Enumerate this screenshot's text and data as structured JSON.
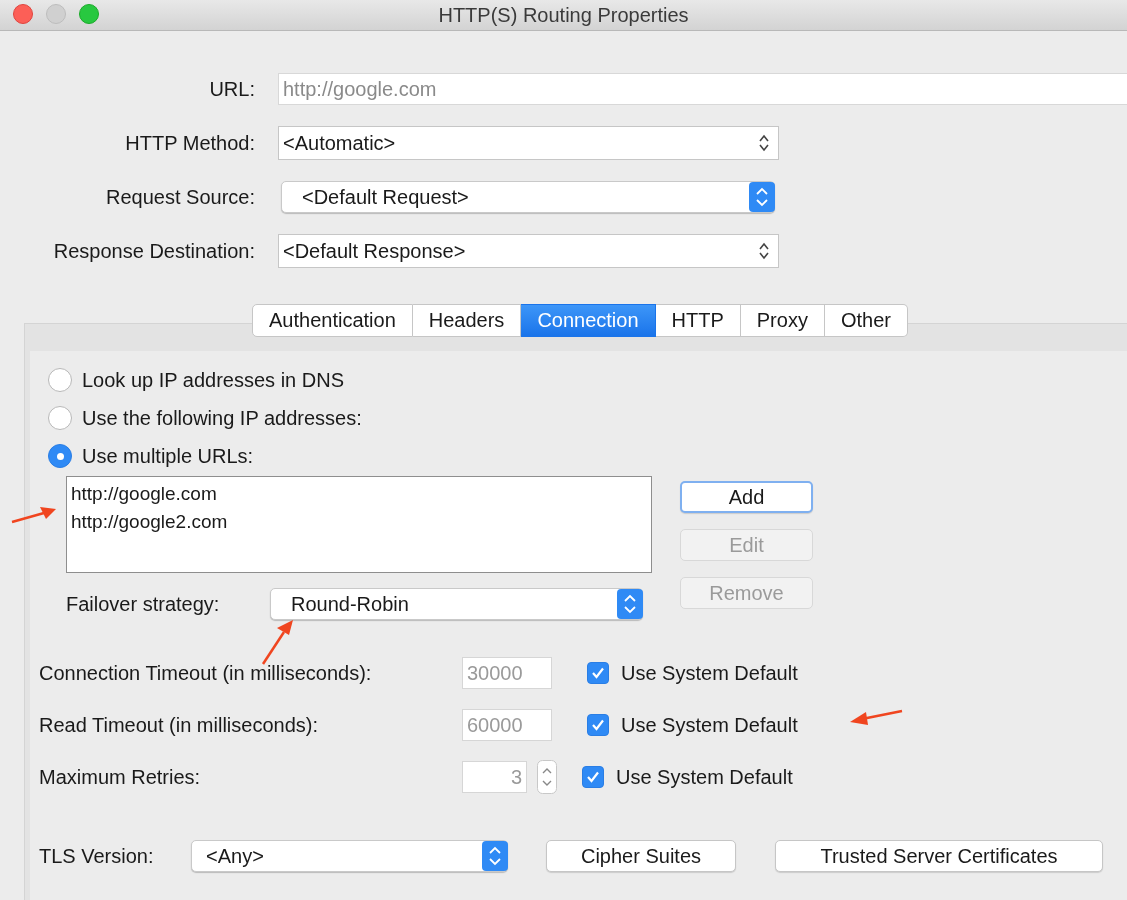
{
  "window": {
    "title": "HTTP(S) Routing Properties"
  },
  "fields": [
    {
      "label": "URL:",
      "kind": "text",
      "value": "http://google.com",
      "disabled": true
    },
    {
      "label": "HTTP Method:",
      "kind": "combo",
      "value": "<Automatic>",
      "disabled": false
    },
    {
      "label": "Request Source:",
      "kind": "popup",
      "value": "<Default Request>",
      "disabled": false
    },
    {
      "label": "Response Destination:",
      "kind": "combo",
      "value": "<Default Response>",
      "disabled": false
    }
  ],
  "tabs": [
    {
      "label": "Authentication",
      "selected": false
    },
    {
      "label": "Headers",
      "selected": false
    },
    {
      "label": "Connection",
      "selected": true
    },
    {
      "label": "HTTP",
      "selected": false
    },
    {
      "label": "Proxy",
      "selected": false
    },
    {
      "label": "Other",
      "selected": false
    }
  ],
  "radios": [
    {
      "label": "Look up IP addresses in DNS",
      "selected": false
    },
    {
      "label": "Use the following IP addresses:",
      "selected": false
    },
    {
      "label": "Use multiple URLs:",
      "selected": true
    }
  ],
  "urls": [
    "http://google.com",
    "http://google2.com"
  ],
  "url_buttons": [
    {
      "label": "Add",
      "disabled": false,
      "focused": true
    },
    {
      "label": "Edit",
      "disabled": true,
      "focused": false
    },
    {
      "label": "Remove",
      "disabled": true,
      "focused": false
    }
  ],
  "failover": {
    "label": "Failover strategy:",
    "value": "Round-Robin"
  },
  "timeouts": [
    {
      "label": "Connection Timeout (in milliseconds):",
      "kind": "text",
      "value": "30000",
      "default_label": "Use System Default",
      "checked": true
    },
    {
      "label": "Read Timeout (in milliseconds):",
      "kind": "text",
      "value": "60000",
      "default_label": "Use System Default",
      "checked": true
    },
    {
      "label": "Maximum Retries:",
      "kind": "spinner",
      "value": "3",
      "default_label": "Use System Default",
      "checked": true
    }
  ],
  "tls": {
    "label": "TLS Version:",
    "value": "<Any>"
  },
  "buttons": [
    "Cipher Suites",
    "Trusted Server Certificates"
  ]
}
